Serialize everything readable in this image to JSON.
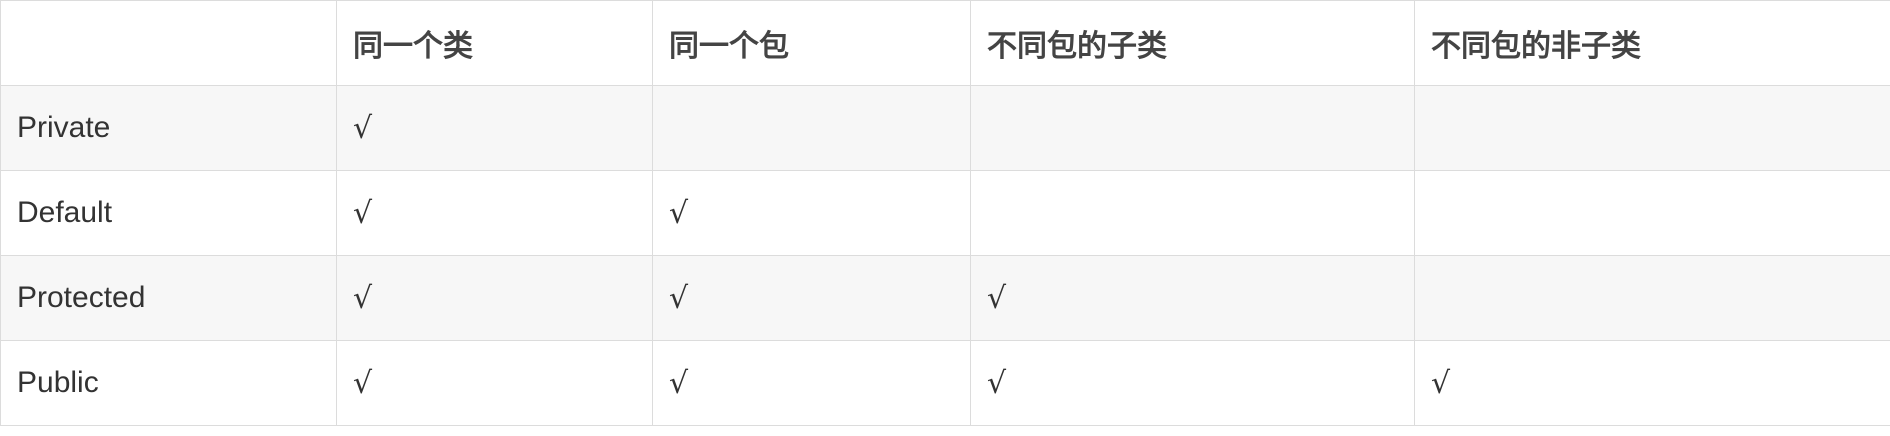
{
  "table": {
    "headers": [
      "",
      "同一个类",
      "同一个包",
      "不同包的子类",
      "不同包的非子类"
    ],
    "rows": [
      {
        "label": "Private",
        "cells": [
          "√",
          "",
          "",
          ""
        ]
      },
      {
        "label": "Default",
        "cells": [
          "√",
          "√",
          "",
          ""
        ]
      },
      {
        "label": "Protected",
        "cells": [
          "√",
          "√",
          "√",
          ""
        ]
      },
      {
        "label": "Public",
        "cells": [
          "√",
          "√",
          "√",
          "√"
        ]
      }
    ]
  }
}
